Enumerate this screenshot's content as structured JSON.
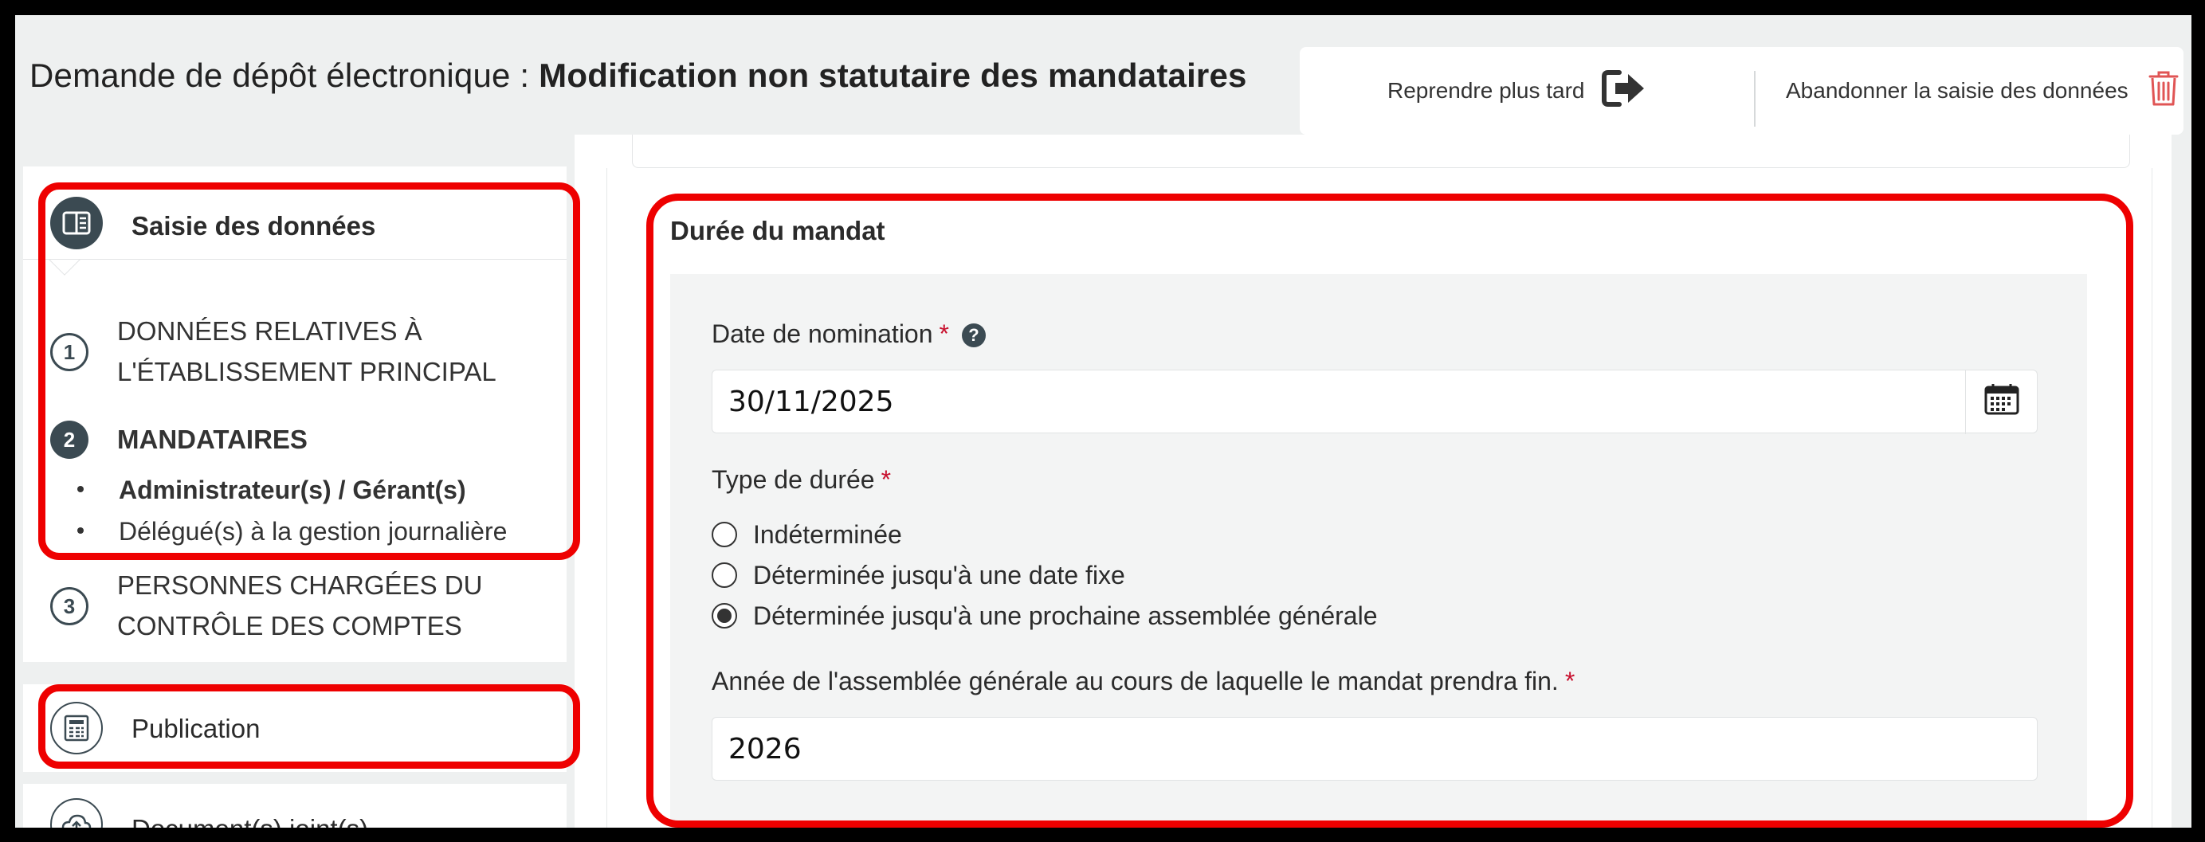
{
  "header": {
    "title_prefix": "Demande de dépôt électronique : ",
    "title_bold": "Modification non statutaire des mandataires",
    "resume_later_label": "Reprendre plus tard",
    "abandon_label": "Abandonner la saisie des données"
  },
  "sidebar": {
    "saisie_title": "Saisie des données",
    "steps": [
      {
        "number": "1",
        "label_line1": "DONNÉES RELATIVES À",
        "label_line2": "L'ÉTABLISSEMENT PRINCIPAL"
      },
      {
        "number": "2",
        "label_line1": "MANDATAIRES"
      },
      {
        "number": "3",
        "label_line1": "PERSONNES CHARGÉES DU",
        "label_line2": "CONTRÔLE DES COMPTES"
      }
    ],
    "sub_items": [
      "Administrateur(s) / Gérant(s)",
      "Délégué(s) à la gestion journalière"
    ],
    "publication_label": "Publication",
    "documents_label": "Document(s) joint(s)"
  },
  "form": {
    "section_title": "Durée du mandat",
    "date_label": "Date de nomination",
    "date_value": "30/11/2025",
    "required_mark": "*",
    "help_mark": "?",
    "type_label": "Type de durée",
    "type_options": [
      {
        "label": "Indéterminée",
        "checked": false
      },
      {
        "label": "Déterminée jusqu'à une date fixe",
        "checked": false
      },
      {
        "label": "Déterminée jusqu'à une prochaine assemblée générale",
        "checked": true
      }
    ],
    "annee_label": "Année de l'assemblée générale au cours de laquelle le mandat prendra fin.",
    "annee_value": "2026"
  },
  "colors": {
    "highlight": "#ee0000",
    "dark_slate": "#3b4a52",
    "required": "#c8102e",
    "trash_red": "#e05555"
  },
  "icons": {
    "resume": "sign-out-arrow-icon",
    "abandon": "trash-icon",
    "saisie": "form-book-icon",
    "publication": "newspaper-icon",
    "documents": "cloud-upload-icon",
    "calendar": "calendar-icon",
    "help": "question-circle-icon"
  }
}
